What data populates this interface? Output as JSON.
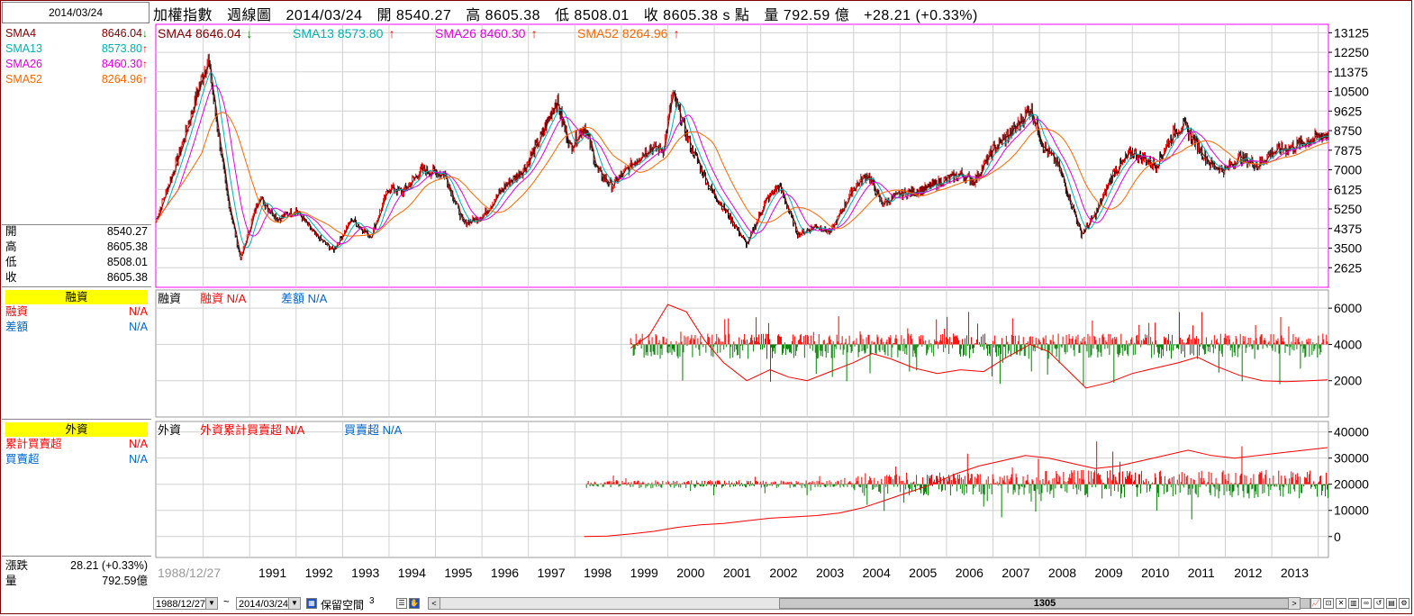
{
  "left_panel": {
    "date": "2014/03/24",
    "sma": [
      {
        "label": "SMA4",
        "value": "8646.04",
        "dir": "down",
        "color": "#800000"
      },
      {
        "label": "SMA13",
        "value": "8573.80",
        "dir": "up",
        "color": "#00b0b0"
      },
      {
        "label": "SMA26",
        "value": "8460.30",
        "dir": "up",
        "color": "#e000e0"
      },
      {
        "label": "SMA52",
        "value": "8264.96",
        "dir": "up",
        "color": "#ff6600"
      }
    ],
    "ohlc": [
      {
        "label": "開",
        "value": "8540.27"
      },
      {
        "label": "高",
        "value": "8605.38"
      },
      {
        "label": "低",
        "value": "8508.01"
      },
      {
        "label": "收",
        "value": "8605.38"
      }
    ],
    "margin": {
      "title": "融資",
      "rows": [
        {
          "label": "融資",
          "value": "N/A",
          "color": "#ff0000"
        },
        {
          "label": "差額",
          "value": "N/A",
          "color": "#0066cc"
        }
      ]
    },
    "foreign": {
      "title": "外資",
      "rows": [
        {
          "label": "累計買賣超",
          "value": "N/A",
          "color": "#ff0000"
        },
        {
          "label": "買賣超",
          "value": "N/A",
          "color": "#0066cc"
        }
      ]
    },
    "summary": [
      {
        "label": "漲跌",
        "value": "28.21 (+0.33%)"
      },
      {
        "label": "量",
        "value": "792.59億"
      }
    ]
  },
  "header": {
    "name": "加權指數",
    "period": "週線圖",
    "date": "2014/03/24",
    "open": "開 8540.27",
    "high": "高 8605.38",
    "low": "低 8508.01",
    "close": "收 8605.38 s 點",
    "volume": "量 792.59 億",
    "change": "+28.21 (+0.33%)"
  },
  "toolbar": {
    "start_date": "1988/12/27",
    "tilde": "~",
    "end_date": "2014/03/24",
    "reserve_label": "保留空間",
    "reserve_value": "3",
    "thumb_label": "1305",
    "left_arrow": "<",
    "right_arrow": ">"
  },
  "chart_data": [
    {
      "type": "line",
      "title": "加權指數 週線圖",
      "legend": [
        {
          "name": "SMA4",
          "value": "8646.04",
          "dir": "down",
          "color": "#800000"
        },
        {
          "name": "SMA13",
          "value": "8573.80",
          "dir": "up",
          "color": "#00b0b0"
        },
        {
          "name": "SMA26",
          "value": "8460.30",
          "dir": "up",
          "color": "#e000e0"
        },
        {
          "name": "SMA52",
          "value": "8264.96",
          "dir": "up",
          "color": "#ff6600"
        }
      ],
      "ylim": [
        1750,
        13500
      ],
      "yticks": [
        "13125",
        "12250",
        "11375",
        "10500",
        "9625",
        "8750",
        "7875",
        "7000",
        "6125",
        "5250",
        "4375",
        "3500",
        "2625"
      ],
      "x": [
        1988.98,
        1989.5,
        1990.1,
        1990.5,
        1990.8,
        1991.2,
        1991.6,
        1992.0,
        1992.4,
        1992.8,
        1993.2,
        1993.6,
        1994.0,
        1994.3,
        1994.7,
        1995.2,
        1995.6,
        1996.0,
        1996.5,
        1996.9,
        1997.3,
        1997.6,
        1997.9,
        1998.2,
        1998.5,
        1998.8,
        1999.3,
        1999.6,
        1999.9,
        2000.1,
        2000.5,
        2000.9,
        2001.3,
        2001.7,
        2002.1,
        2002.4,
        2002.8,
        2003.2,
        2003.5,
        2004.0,
        2004.3,
        2004.6,
        2005.0,
        2005.5,
        2005.9,
        2006.3,
        2006.6,
        2007.0,
        2007.5,
        2007.8,
        2008.1,
        2008.4,
        2008.7,
        2008.9,
        2009.2,
        2009.6,
        2010.0,
        2010.5,
        2010.9,
        2011.1,
        2011.4,
        2011.7,
        2012.0,
        2012.3,
        2012.7,
        2013.0,
        2013.4,
        2013.8,
        2014.2
      ],
      "close": [
        4700,
        7800,
        11983,
        6000,
        3000,
        5800,
        4800,
        5200,
        4100,
        3400,
        4800,
        4000,
        6200,
        6000,
        7000,
        6800,
        4600,
        4900,
        6300,
        7000,
        8600,
        10116,
        8000,
        9000,
        6900,
        6300,
        7400,
        8000,
        7900,
        10393,
        8000,
        6200,
        5000,
        3636,
        5600,
        6300,
        4100,
        4500,
        4200,
        6200,
        6800,
        5500,
        5900,
        6100,
        6500,
        6800,
        6500,
        7900,
        8900,
        9800,
        8000,
        7200,
        5400,
        4100,
        5000,
        6900,
        7800,
        7200,
        8700,
        9000,
        8100,
        7200,
        7000,
        7600,
        7200,
        7800,
        8000,
        8300,
        8605
      ]
    },
    {
      "type": "bar",
      "title": "融資",
      "legend": [
        {
          "name": "融資",
          "value": "N/A"
        },
        {
          "name": "差額",
          "value": "N/A"
        }
      ],
      "ylim": [
        0,
        7000
      ],
      "yticks": [
        "6000",
        "4000",
        "2000"
      ],
      "line_x": [
        1999.2,
        1999.6,
        2000.0,
        2000.4,
        2000.8,
        2001.2,
        2001.7,
        2002.2,
        2002.6,
        2003.0,
        2003.5,
        2004.0,
        2004.4,
        2004.8,
        2005.3,
        2005.8,
        2006.3,
        2006.8,
        2007.3,
        2007.8,
        2008.2,
        2008.6,
        2009.0,
        2009.5,
        2010.0,
        2010.5,
        2011.0,
        2011.4,
        2011.8,
        2012.3,
        2012.8,
        2013.3,
        2013.8,
        2014.2
      ],
      "line_y": [
        3800,
        4500,
        6200,
        5800,
        4200,
        3000,
        2000,
        2600,
        2200,
        2000,
        2500,
        3000,
        3500,
        3200,
        2700,
        2400,
        2600,
        2500,
        3300,
        4000,
        3600,
        2600,
        1600,
        1900,
        2400,
        2700,
        3000,
        3300,
        2800,
        2300,
        2000,
        1950,
        2000,
        2050
      ],
      "bar_baseline": 4000
    },
    {
      "type": "bar",
      "title": "外資",
      "legend": [
        {
          "name": "外資累計買賣超",
          "value": "N/A"
        },
        {
          "name": "買賣超",
          "value": "N/A"
        }
      ],
      "ylim": [
        -8000,
        44000
      ],
      "yticks": [
        "40000",
        "30000",
        "20000",
        "10000",
        "0"
      ],
      "line_x": [
        1998.2,
        1998.7,
        1999.2,
        1999.7,
        2000.2,
        2000.7,
        2001.2,
        2001.7,
        2002.2,
        2002.7,
        2003.2,
        2003.7,
        2004.2,
        2004.7,
        2005.2,
        2005.7,
        2006.2,
        2006.7,
        2007.2,
        2007.7,
        2008.2,
        2008.7,
        2009.2,
        2009.7,
        2010.2,
        2010.7,
        2011.2,
        2011.7,
        2012.2,
        2012.7,
        2013.2,
        2013.7,
        2014.2
      ],
      "line_y": [
        0,
        200,
        1000,
        2000,
        3500,
        4500,
        5000,
        6000,
        7000,
        7500,
        8000,
        9000,
        11000,
        14000,
        17000,
        20000,
        24000,
        27000,
        29000,
        31000,
        30000,
        28000,
        26000,
        27000,
        29000,
        31000,
        33000,
        31000,
        30000,
        31000,
        32000,
        33000,
        34000
      ],
      "bar_baseline": 20000
    }
  ],
  "x_axis": {
    "labels": [
      "1988/12/27",
      "1991",
      "1992",
      "1993",
      "1994",
      "1995",
      "1996",
      "1997",
      "1998",
      "1999",
      "2000",
      "2001",
      "2002",
      "2003",
      "2004",
      "2005",
      "2006",
      "2007",
      "2008",
      "2009",
      "2010",
      "2011",
      "2012",
      "2013"
    ]
  }
}
